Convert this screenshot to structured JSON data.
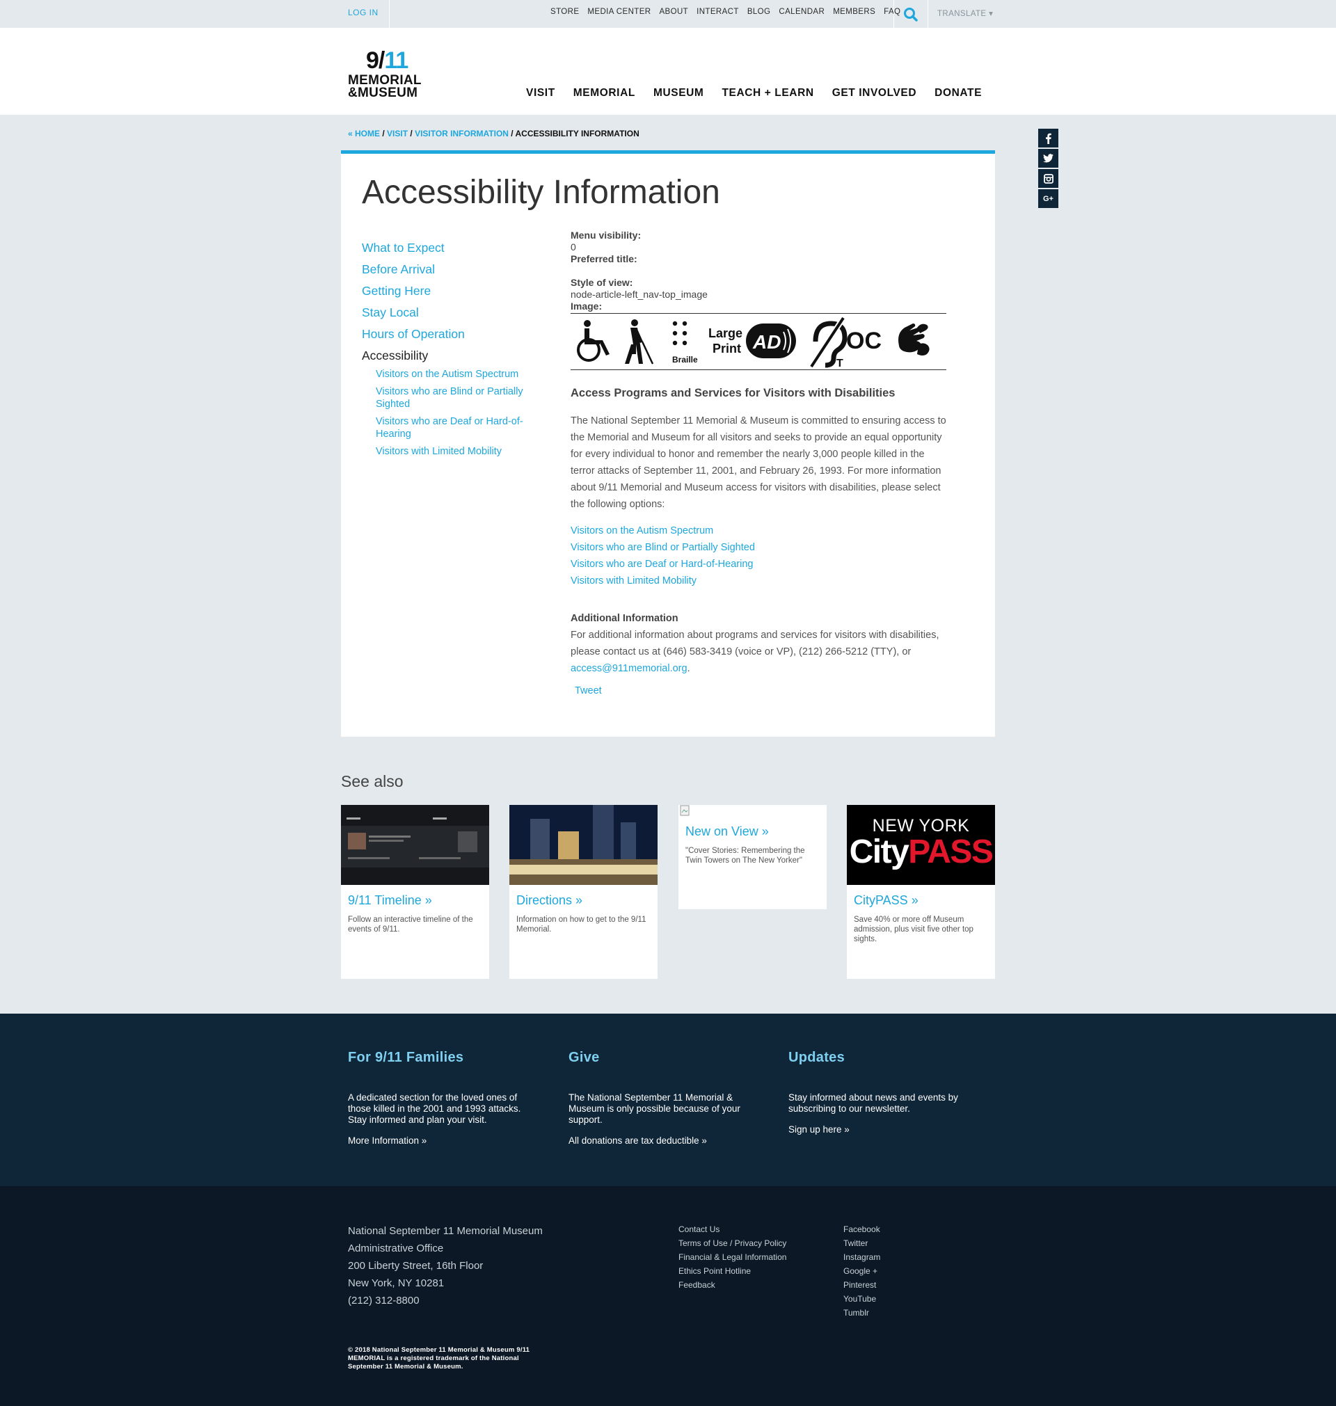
{
  "topbar": {
    "login": "LOG IN",
    "links": [
      "STORE",
      "MEDIA CENTER",
      "ABOUT",
      "INTERACT",
      "BLOG",
      "CALENDAR",
      "MEMBERS",
      "FAQ"
    ],
    "translate": "TRANSLATE ▾"
  },
  "logo": {
    "num_a": "9/",
    "num_b": "11",
    "line1": "MEMORIAL",
    "line2": "&MUSEUM"
  },
  "mainnav": [
    "VISIT",
    "MEMORIAL",
    "MUSEUM",
    "TEACH + LEARN",
    "GET INVOLVED",
    "DONATE"
  ],
  "social": [
    "f",
    "t",
    "ig",
    "g+"
  ],
  "breadcrumb": {
    "home": "« HOME",
    "visit": "VISIT",
    "visitor_info": "VISITOR INFORMATION",
    "current": "ACCESSIBILITY INFORMATION",
    "sep": " / "
  },
  "page_title": "Accessibility Information",
  "leftnav": {
    "items": [
      "What to Expect",
      "Before Arrival",
      "Getting Here",
      "Stay Local",
      "Hours of Operation"
    ],
    "active": "Accessibility",
    "sub": [
      "Visitors on the Autism Spectrum",
      "Visitors who are Blind or Partially Sighted",
      "Visitors who are Deaf or Hard-of-Hearing",
      "Visitors with Limited Mobility"
    ]
  },
  "meta": {
    "menu_visibility_label": "Menu visibility:",
    "menu_visibility_value": "0",
    "preferred_title_label": "Preferred title:",
    "style_label": "Style of view:",
    "style_value": "node-article-left_nav-top_image",
    "image_label": "Image:"
  },
  "iconstrip": {
    "braille": "Braille",
    "large": "Large",
    "print": "Print",
    "ad": "AD",
    "t": "T",
    "oc": "OC"
  },
  "content": {
    "heading": "Access Programs and Services for Visitors with Disabilities",
    "body": "The National September 11 Memorial & Museum is committed to ensuring access to the Memorial and Museum for all visitors and seeks to provide an equal opportunity for every individual to honor and remember the nearly 3,000 people killed in the terror attacks of September 11, 2001, and February 26, 1993. For more information about 9/11 Memorial and Museum access for visitors with disabilities, please select the following options:",
    "options": [
      "Visitors on the Autism Spectrum",
      "Visitors who are Blind or Partially Sighted",
      "Visitors who are Deaf or Hard-of-Hearing",
      "Visitors with Limited Mobility"
    ],
    "addl_heading": "Additional Information",
    "addl_text": "For additional information about programs and services for visitors with disabilities, please contact us at (646) 583-3419 (voice or VP), (212) 266-5212 (TTY), or ",
    "addl_email": "access@911memorial.org",
    "addl_end": ".",
    "tweet": "Tweet"
  },
  "seealso": {
    "title": "See also",
    "cards": [
      {
        "title": "9/11 Timeline »",
        "desc": "Follow an interactive timeline of the events of 9/11."
      },
      {
        "title": "Directions »",
        "desc": "Information on how to get to the 9/11 Memorial."
      },
      {
        "title": "New on View »",
        "desc": "\"Cover Stories: Remembering the Twin Towers on The New Yorker\""
      },
      {
        "title": "CityPASS »",
        "desc": "Save 40% or more off Museum admission, plus visit five other top sights."
      }
    ],
    "citypass_top": "NEW YORK",
    "citypass_city": "City",
    "citypass_pass": "PASS"
  },
  "footer": {
    "cols": [
      {
        "title": "For 9/11 Families",
        "text": "A dedicated section for the loved ones of those killed in the 2001 and 1993 attacks. Stay informed and plan your visit.",
        "link": "More Information »"
      },
      {
        "title": "Give",
        "text": "The National September 11 Memorial & Museum is only possible because of your support.",
        "link": "All donations are tax deductible »"
      },
      {
        "title": "Updates",
        "text": "Stay informed about news and events by subscribing to our newsletter.",
        "link": "Sign up here »"
      }
    ],
    "address": [
      "National September 11 Memorial Museum",
      "Administrative Office",
      "200 Liberty Street, 16th Floor",
      "New York, NY 10281",
      "(212) 312-8800"
    ],
    "links1": [
      "Contact Us",
      "Terms of Use / Privacy Policy",
      "Financial & Legal Information",
      "Ethics Point Hotline",
      "Feedback"
    ],
    "links2": [
      "Facebook",
      "Twitter",
      "Instagram",
      "Google +",
      "Pinterest",
      "YouTube",
      "Tumblr"
    ],
    "copyright": "© 2018 National September 11 Memorial & Museum 9/11 MEMORIAL is a registered trademark of the National September 11 Memorial & Museum."
  },
  "colors": {
    "accent": "#1ea7dd",
    "footer_dark": "#0f2538",
    "footer_darker": "#0c1826",
    "page_bg": "#e3e9ec"
  }
}
